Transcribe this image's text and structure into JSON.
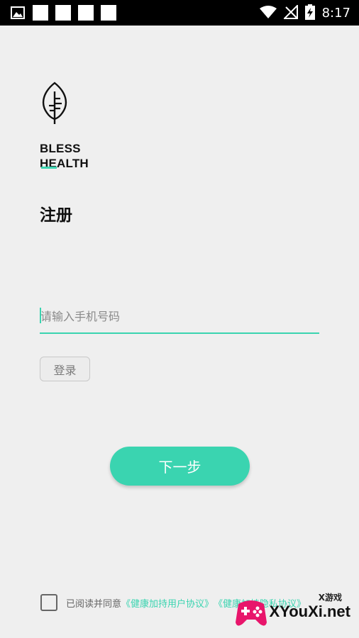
{
  "status_bar": {
    "time": "8:17",
    "left_icons": [
      "image-icon",
      "notification-square",
      "notification-square",
      "notification-square",
      "notification-square"
    ],
    "right_icons": [
      "wifi-icon",
      "no-signal-icon",
      "battery-charging-icon"
    ]
  },
  "brand": {
    "line1": "BLESS",
    "line2": "HEALTH",
    "accent_color": "#3ad4b0"
  },
  "page": {
    "title": "注册"
  },
  "form": {
    "phone_placeholder": "请输入手机号码",
    "phone_value": "",
    "login_label": "登录",
    "next_label": "下一步"
  },
  "agreement": {
    "checked": false,
    "prefix": "已阅读并同意",
    "link1": "《健康加持用户协议》",
    "link2": "《健康加持隐私协议》"
  },
  "watermark": {
    "small": "X游戏",
    "big": "XYouXi.net"
  }
}
